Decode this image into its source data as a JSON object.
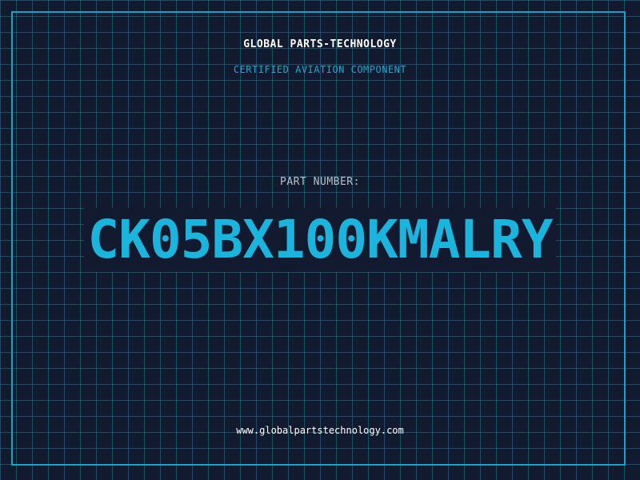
{
  "header": {
    "company_name": "GLOBAL PARTS-TECHNOLOGY",
    "tagline": "CERTIFIED AVIATION COMPONENT"
  },
  "part": {
    "label": "PART NUMBER:",
    "number": "CK05BX100KMALRY"
  },
  "footer": {
    "website": "www.globalpartstechnology.com"
  },
  "colors": {
    "background": "#111a2e",
    "grid": "#287896",
    "accent": "#1bb4dd",
    "text_primary": "#ffffff",
    "text_muted": "#b9c2cc"
  }
}
